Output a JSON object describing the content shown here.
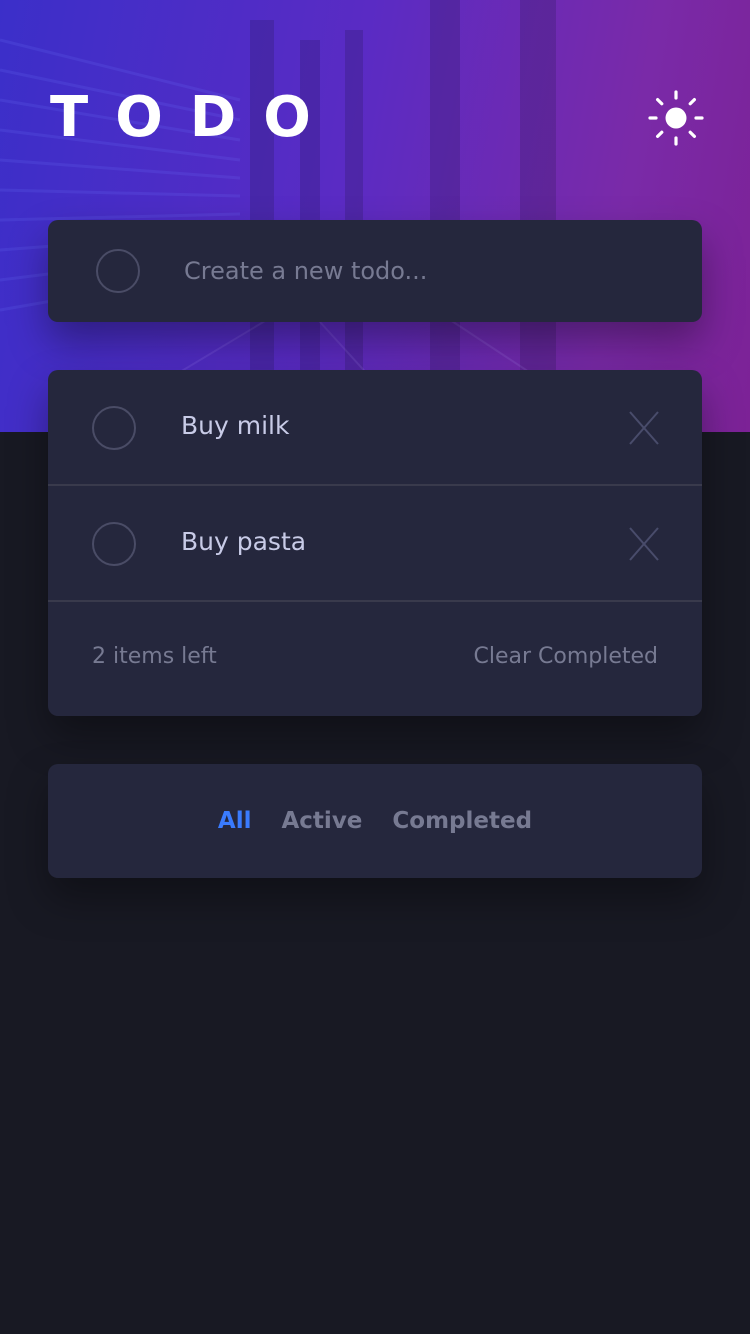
{
  "app": {
    "title": "TODO",
    "theme_icon": "sun-icon"
  },
  "new_todo": {
    "placeholder": "Create a new todo..."
  },
  "todos": [
    {
      "text": "Buy milk",
      "completed": false
    },
    {
      "text": "Buy pasta",
      "completed": false
    }
  ],
  "footer": {
    "items_left": "2 items left",
    "clear_label": "Clear Completed"
  },
  "filters": [
    {
      "label": "All",
      "active": true
    },
    {
      "label": "Active",
      "active": false
    },
    {
      "label": "Completed",
      "active": false
    }
  ],
  "colors": {
    "accent": "#3a7bfd",
    "card": "#25273d",
    "background": "#181923",
    "text": "#c8cbe7",
    "muted": "#777a92"
  }
}
